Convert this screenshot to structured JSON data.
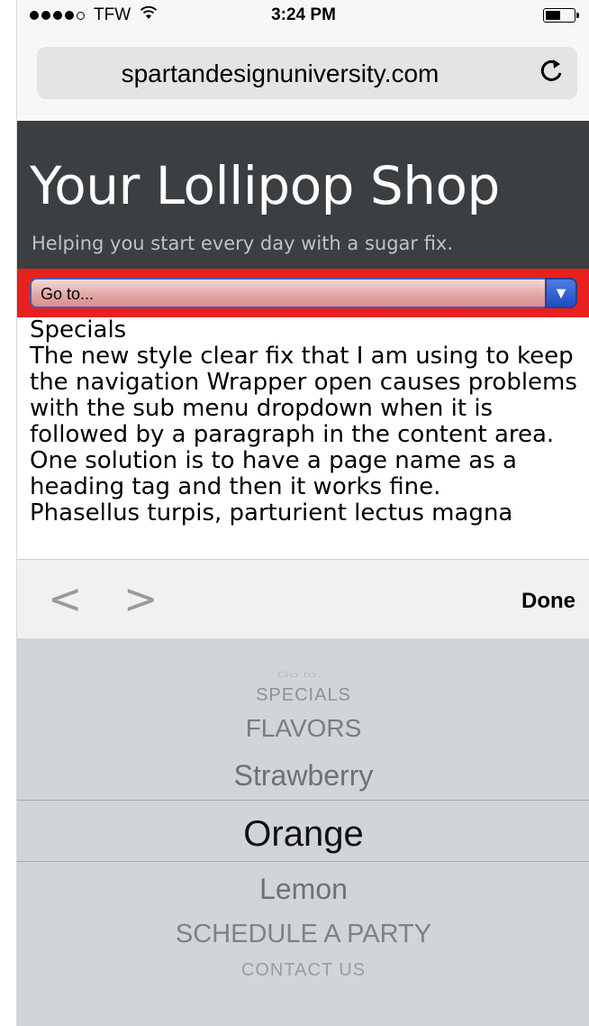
{
  "status_bar": {
    "carrier": "TFW",
    "time": "3:24 PM"
  },
  "address_bar": {
    "url": "spartandesignuniversity.com"
  },
  "site": {
    "title": "Your Lollipop Shop",
    "tagline": "Helping you start every day with a sugar fix.",
    "goto_label": "Go to..."
  },
  "content": {
    "heading": "Specials",
    "paragraph": "The new style clear fix that I am using to keep the navigation Wrapper open causes problems with the sub menu dropdown when it is followed by a paragraph in the content area. One solution is to have a page name as a heading tag and then it works fine.",
    "cut_line": "Phasellus turpis, parturient lectus magna"
  },
  "toolbar": {
    "done_label": "Done"
  },
  "picker": {
    "options": [
      "Go to...",
      "SPECIALS",
      "FLAVORS",
      "Strawberry",
      "Orange",
      "Lemon",
      "SCHEDULE A PARTY",
      "CONTACT US"
    ],
    "selected": "Orange"
  }
}
